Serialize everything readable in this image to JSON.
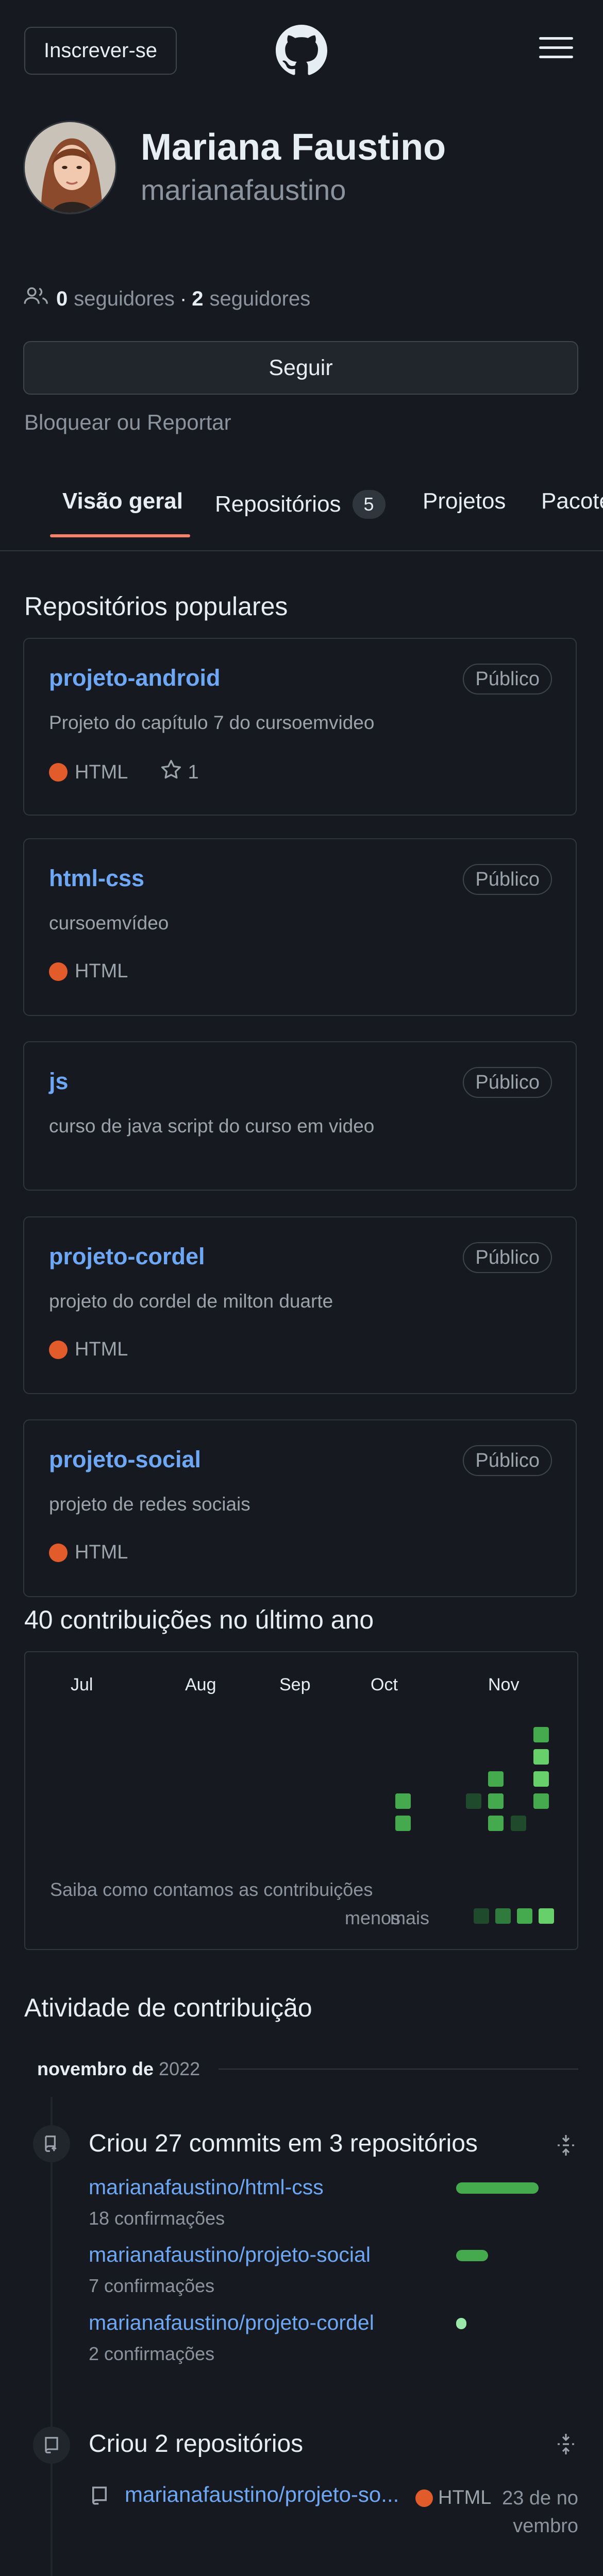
{
  "header": {
    "signup_label": "Inscrever-se"
  },
  "profile": {
    "name": "Mariana Faustino",
    "username": "marianafaustino",
    "followers_count": "0",
    "followers_label": "seguidores",
    "separator": "·",
    "following_count": "2",
    "following_label": "seguidores",
    "follow_label": "Seguir",
    "block_label": "Bloquear ou Reportar"
  },
  "tabs": [
    {
      "label": "Visão geral"
    },
    {
      "label": "Repositórios",
      "count": "5"
    },
    {
      "label": "Projetos"
    },
    {
      "label": "Pacotes"
    }
  ],
  "popular": {
    "title": "Repositórios populares",
    "repos": [
      {
        "name": "projeto-android",
        "visibility": "Público",
        "description": "Projeto do capítulo 7 do cursoemvideo",
        "language": "HTML",
        "stars": "1"
      },
      {
        "name": "html-css",
        "visibility": "Público",
        "description": "cursoemvídeo",
        "language": "HTML"
      },
      {
        "name": "js",
        "visibility": "Público",
        "description": "curso de java script do curso em video"
      },
      {
        "name": "projeto-cordel",
        "visibility": "Público",
        "description": "projeto do cordel de milton duarte",
        "language": "HTML"
      },
      {
        "name": "projeto-social",
        "visibility": "Público",
        "description": "projeto de redes sociais",
        "language": "HTML"
      }
    ]
  },
  "contributions": {
    "title": "40 contribuições no último ano",
    "months": [
      "Jul",
      "Aug",
      "Sep",
      "Oct",
      "Nov"
    ],
    "help_link": "Saiba como contamos as contribuições",
    "legend_less": "menos",
    "legend_more": "mais",
    "colors": {
      "level1": "#1f4a2c",
      "level2": "#2f7a3d",
      "level3": "#45a94e",
      "level4": "#67d06a",
      "empty": "#1c232c"
    }
  },
  "activity": {
    "title": "Atividade de contribuição",
    "month_label": "novembro de",
    "year_label": "2022",
    "commits": {
      "title": "Criou 27 commits em 3 repositórios",
      "items": [
        {
          "repo": "marianafaustino/html-css",
          "count": "18 confirmações",
          "fraction": 1.0
        },
        {
          "repo": "marianafaustino/projeto-social",
          "count": "7 confirmações",
          "fraction": 0.39
        },
        {
          "repo": "marianafaustino/projeto-cordel",
          "count": "2 confirmações",
          "fraction": 0.11
        }
      ]
    },
    "created": {
      "title": "Criou 2 repositórios",
      "items": [
        {
          "repo": "marianafaustino/projeto-so...",
          "language": "HTML",
          "date": "23 de novembro"
        }
      ]
    }
  }
}
